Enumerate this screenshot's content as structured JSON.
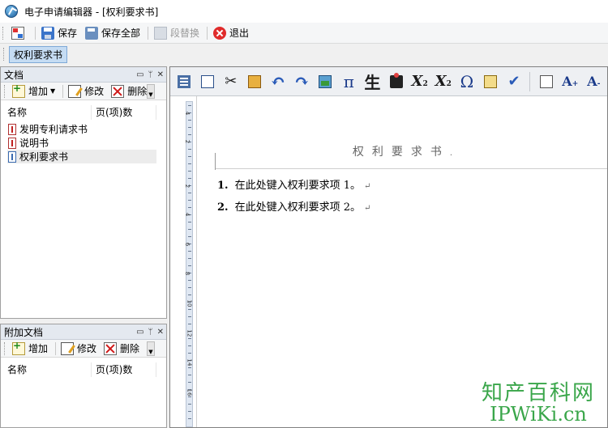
{
  "window": {
    "title": "电子申请编辑器 - [权利要求书]"
  },
  "toolbar": {
    "save": "保存",
    "save_all": "保存全部",
    "replace": "段替换",
    "exit": "退出"
  },
  "tabs": {
    "active": "权利要求书"
  },
  "documents_panel": {
    "title": "文档",
    "add": "增加",
    "edit": "修改",
    "delete": "删除",
    "col_name": "名称",
    "col_pages": "页(项)数",
    "items": [
      {
        "name": "发明专利请求书"
      },
      {
        "name": "说明书"
      },
      {
        "name": "权利要求书"
      }
    ]
  },
  "attachments_panel": {
    "title": "附加文档",
    "add": "增加",
    "edit": "修改",
    "delete": "删除",
    "col_name": "名称",
    "col_pages": "页(项)数"
  },
  "editor_toolbar": {
    "pi": "π",
    "sheng": "生",
    "sup_base": "X",
    "sup_exp": "2",
    "sub_base": "X",
    "sub_exp": "2",
    "omega": "Ω",
    "font_big": "A",
    "font_big_sup": "+",
    "font_small": "A",
    "font_small_sup": "-"
  },
  "document": {
    "title": "权利要求书",
    "claims": [
      {
        "num": "1.",
        "text": "在此处键入权利要求项 1。"
      },
      {
        "num": "2.",
        "text": "在此处键入权利要求项 2。"
      }
    ]
  },
  "ruler": {
    "labels": [
      "4",
      "2",
      "2",
      "4",
      "6",
      "8",
      "10",
      "12",
      "14",
      "16"
    ]
  },
  "watermark": {
    "line1": "知产百科网",
    "line2": "IPWiKi.cn"
  }
}
